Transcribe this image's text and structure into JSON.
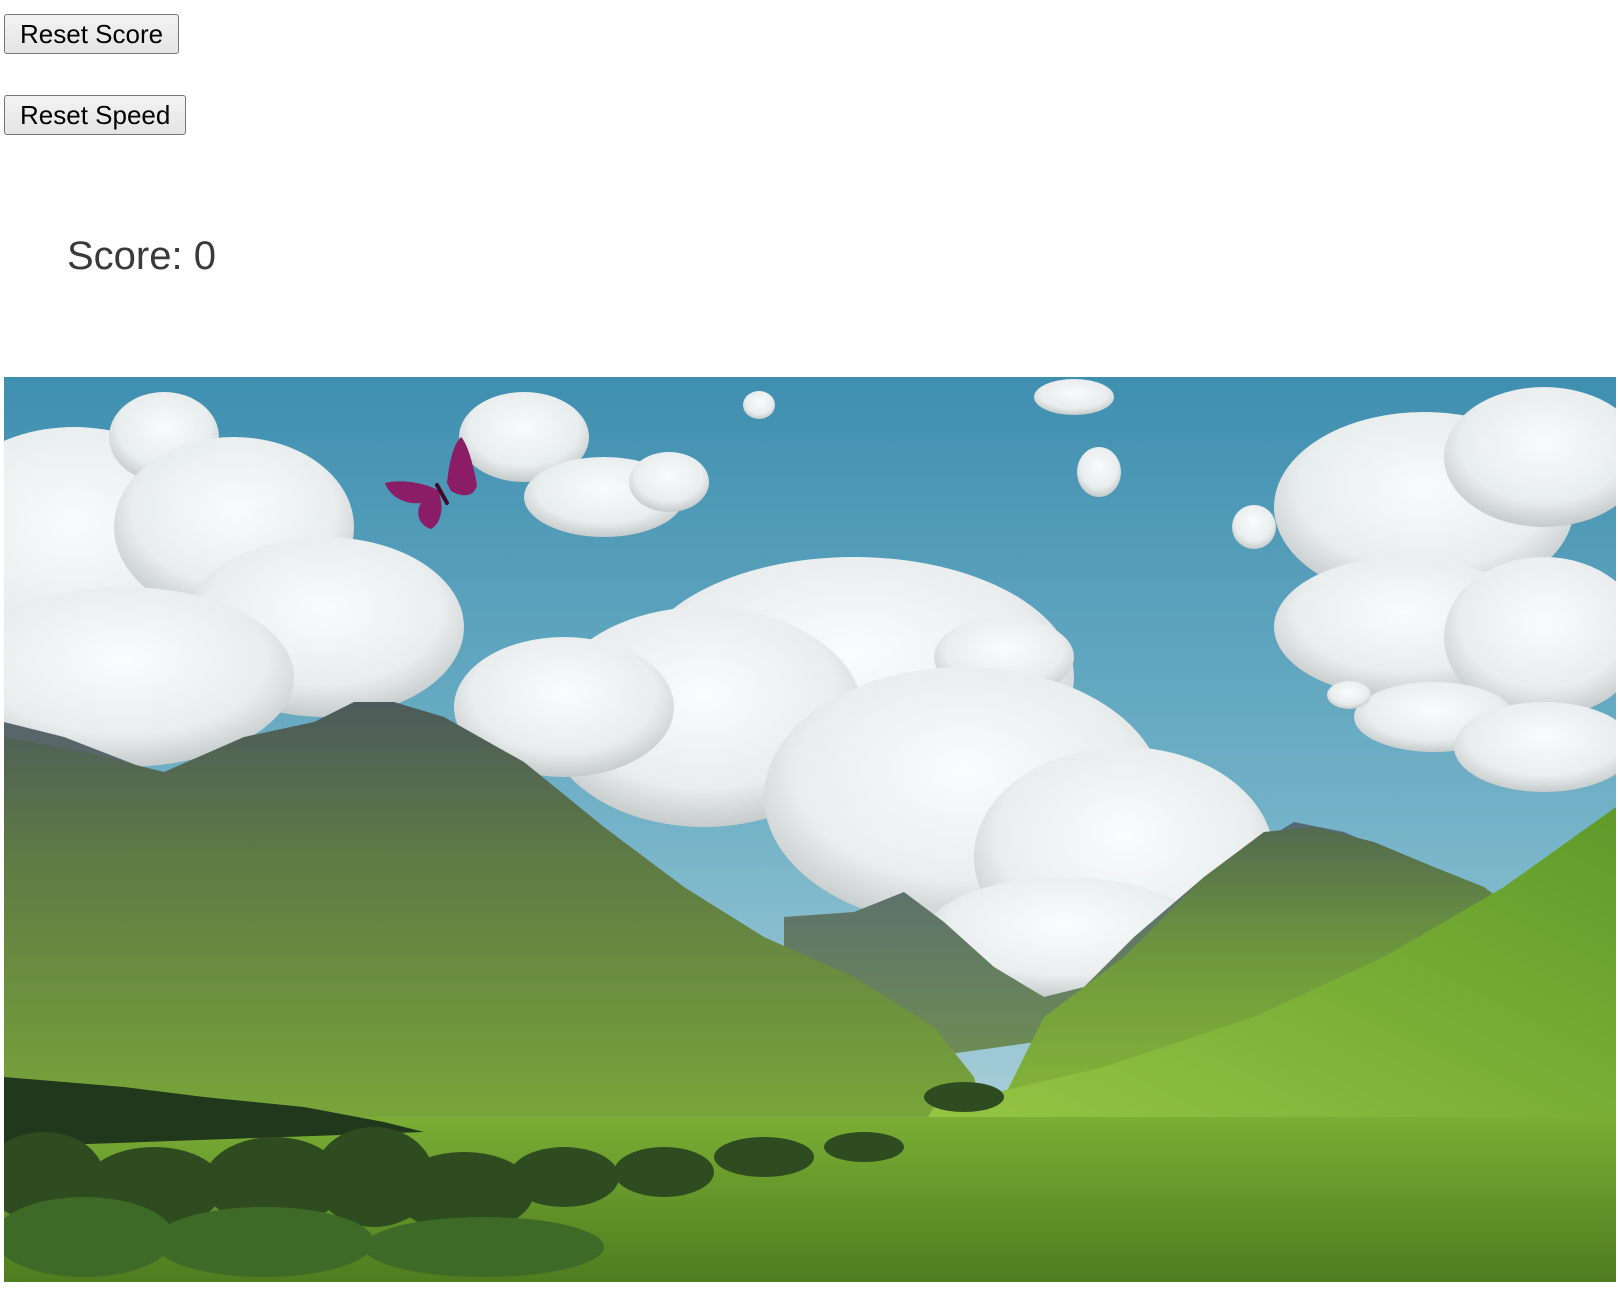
{
  "controls": {
    "reset_score_label": "Reset Score",
    "reset_speed_label": "Reset Speed"
  },
  "score": {
    "text": "Score: 0",
    "value": 0
  },
  "scene": {
    "background": "mountain-valley-landscape",
    "sprite": "butterfly-icon",
    "colors": {
      "sky": "#5fa5c0",
      "butterfly": "#8a1d66",
      "grass": "#6a9a2c"
    }
  }
}
